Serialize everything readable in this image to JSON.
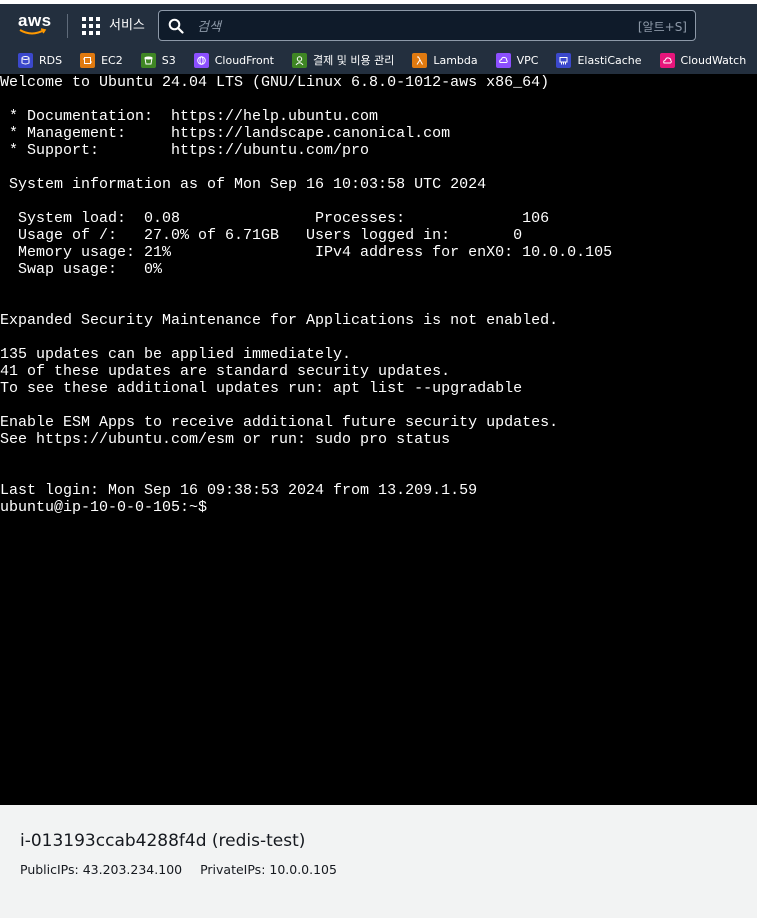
{
  "topnav": {
    "logo_text": "aws",
    "services_label": "서비스",
    "search_placeholder": "검색",
    "search_shortcut": "[알트+S]"
  },
  "favorites": [
    {
      "label": "RDS",
      "icon": "rds-icon",
      "color": "#3b48cc"
    },
    {
      "label": "EC2",
      "icon": "ec2-icon",
      "color": "#e07a10"
    },
    {
      "label": "S3",
      "icon": "s3-icon",
      "color": "#3f8624"
    },
    {
      "label": "CloudFront",
      "icon": "cloudfront-icon",
      "color": "#8c4fff"
    },
    {
      "label": "결제 및 비용 관리",
      "icon": "billing-icon",
      "color": "#3f8624"
    },
    {
      "label": "Lambda",
      "icon": "lambda-icon",
      "color": "#e07a10"
    },
    {
      "label": "VPC",
      "icon": "vpc-icon",
      "color": "#8c4fff"
    },
    {
      "label": "ElastiCache",
      "icon": "elasticache-icon",
      "color": "#3b48cc"
    },
    {
      "label": "CloudWatch",
      "icon": "cloudwatch-icon",
      "color": "#e7157b"
    }
  ],
  "terminal": {
    "lines": [
      "Welcome to Ubuntu 24.04 LTS (GNU/Linux 6.8.0-1012-aws x86_64)",
      "",
      " * Documentation:  https://help.ubuntu.com",
      " * Management:     https://landscape.canonical.com",
      " * Support:        https://ubuntu.com/pro",
      "",
      " System information as of Mon Sep 16 10:03:58 UTC 2024",
      "",
      "  System load:  0.08               Processes:             106",
      "  Usage of /:   27.0% of 6.71GB   Users logged in:       0",
      "  Memory usage: 21%                IPv4 address for enX0: 10.0.0.105",
      "  Swap usage:   0%",
      "",
      "",
      "Expanded Security Maintenance for Applications is not enabled.",
      "",
      "135 updates can be applied immediately.",
      "41 of these updates are standard security updates.",
      "To see these additional updates run: apt list --upgradable",
      "",
      "Enable ESM Apps to receive additional future security updates.",
      "See https://ubuntu.com/esm or run: sudo pro status",
      "",
      "",
      "Last login: Mon Sep 16 09:38:53 2024 from 13.209.1.59",
      "ubuntu@ip-10-0-0-105:~$"
    ]
  },
  "footer": {
    "instance_title": "i-013193ccab4288f4d (redis-test)",
    "public_ips": "PublicIPs: 43.203.234.100",
    "private_ips": "PrivateIPs: 10.0.0.105"
  }
}
